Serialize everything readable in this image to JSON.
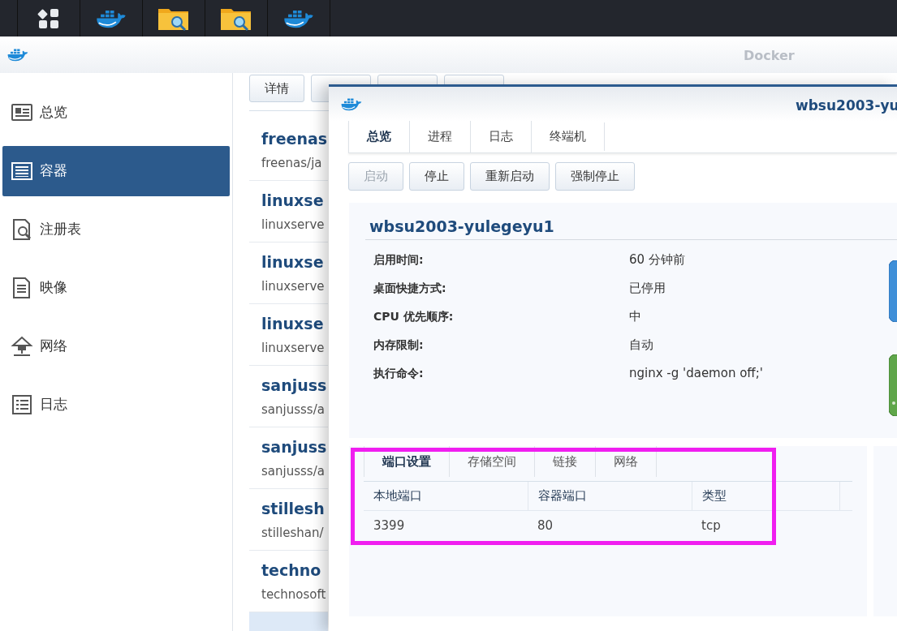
{
  "taskbar": {
    "items": [
      {
        "kind": "apps"
      },
      {
        "kind": "docker"
      },
      {
        "kind": "folder"
      },
      {
        "kind": "folder"
      },
      {
        "kind": "docker"
      }
    ]
  },
  "app": {
    "title": "Docker"
  },
  "sidebar": {
    "items": [
      {
        "label": "总览",
        "selected": false
      },
      {
        "label": "容器",
        "selected": true
      },
      {
        "label": "注册表",
        "selected": false
      },
      {
        "label": "映像",
        "selected": false
      },
      {
        "label": "网络",
        "selected": false
      },
      {
        "label": "日志",
        "selected": false
      }
    ]
  },
  "toolbar": {
    "buttons": [
      {
        "kind": "labeled",
        "label": "详情"
      },
      {
        "kind": "covered"
      },
      {
        "kind": "covered"
      },
      {
        "kind": "covered"
      }
    ]
  },
  "containers": [
    {
      "name": "freenas",
      "image": "freenas/ja",
      "selected": false
    },
    {
      "name": "linuxse",
      "image": "linuxserve",
      "selected": false
    },
    {
      "name": "linuxse",
      "image": "linuxserve",
      "selected": false
    },
    {
      "name": "linuxse",
      "image": "linuxserve",
      "selected": false
    },
    {
      "name": "sanjuss",
      "image": "sanjusss/a",
      "selected": false
    },
    {
      "name": "sanjuss",
      "image": "sanjusss/a",
      "selected": false
    },
    {
      "name": "stillesh",
      "image": "stilleshan/",
      "selected": false
    },
    {
      "name": "techno",
      "image": "technosoft",
      "selected": false
    },
    {
      "selected": true
    }
  ],
  "detail_window": {
    "title": "wbsu2003-yu",
    "tabs": [
      {
        "label": "总览",
        "selected": true
      },
      {
        "label": "进程",
        "selected": false
      },
      {
        "label": "日志",
        "selected": false
      },
      {
        "label": "终端机",
        "selected": false
      }
    ],
    "buttons": [
      {
        "label": "启动",
        "disabled": true
      },
      {
        "label": "停止",
        "disabled": false
      },
      {
        "label": "重新启动",
        "disabled": false
      },
      {
        "label": "强制停止",
        "disabled": false
      }
    ],
    "name": "wbsu2003-yulegeyu1",
    "fields": [
      {
        "label": "启用时间:",
        "value": "60 分钟前"
      },
      {
        "label": "桌面快捷方式:",
        "value": "已停用"
      },
      {
        "label": "CPU 优先顺序:",
        "value": "中"
      },
      {
        "label": "内存限制:",
        "value": "自动"
      },
      {
        "label": "执行命令:",
        "value": "nginx -g 'daemon off;'"
      }
    ],
    "settings_tabs": [
      {
        "label": "端口设置",
        "selected": true
      },
      {
        "label": "存储空间",
        "selected": false
      },
      {
        "label": "链接",
        "selected": false
      },
      {
        "label": "网络",
        "selected": false
      }
    ],
    "ports": {
      "columns": [
        "本地端口",
        "容器端口",
        "类型"
      ],
      "rows": [
        [
          "3399",
          "80",
          "tcp"
        ]
      ]
    }
  }
}
